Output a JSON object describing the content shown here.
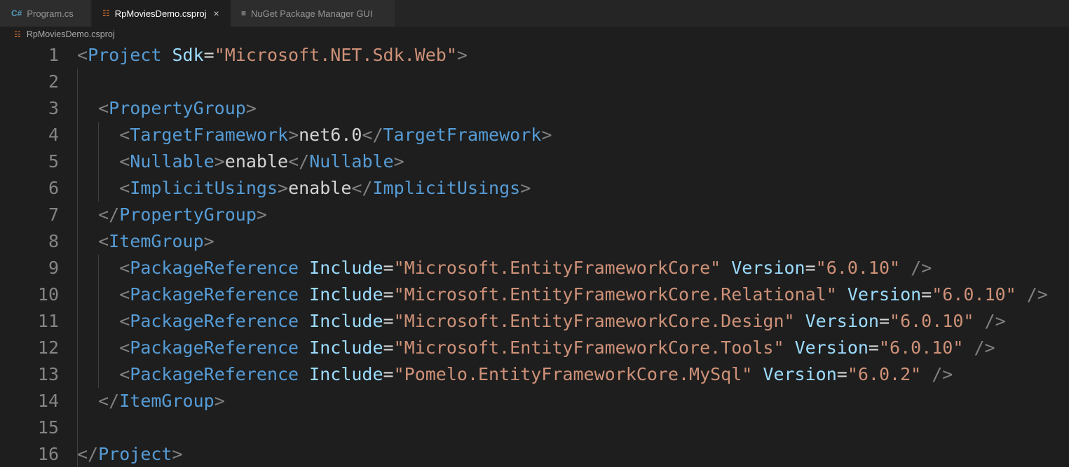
{
  "tabs": [
    {
      "icon": "csharp-file-icon",
      "label": "Program.cs",
      "active": false
    },
    {
      "icon": "rss-file-icon",
      "label": "RpMoviesDemo.csproj",
      "active": true,
      "close": "×"
    },
    {
      "icon": "preview-lines-icon",
      "label": "NuGet Package Manager GUI",
      "active": false
    }
  ],
  "breadcrumb": {
    "file": "RpMoviesDemo.csproj"
  },
  "colors": {
    "tag": "#569cd6",
    "attribute": "#9cdcfe",
    "string": "#ce9178",
    "punctuation": "#808080",
    "text": "#d4d4d4",
    "line_number": "#858585",
    "background": "#1e1e1e"
  },
  "lines": [
    {
      "n": "1",
      "tokens": [
        [
          "p",
          "<"
        ],
        [
          "t",
          "Project"
        ],
        [
          "x",
          " "
        ],
        [
          "a",
          "Sdk"
        ],
        [
          "x",
          "="
        ],
        [
          "s",
          "\"Microsoft.NET.Sdk.Web\""
        ],
        [
          "p",
          ">"
        ]
      ]
    },
    {
      "n": "2",
      "tokens": []
    },
    {
      "n": "3",
      "tokens": [
        [
          "x",
          "  "
        ],
        [
          "p",
          "<"
        ],
        [
          "t",
          "PropertyGroup"
        ],
        [
          "p",
          ">"
        ]
      ]
    },
    {
      "n": "4",
      "tokens": [
        [
          "x",
          "    "
        ],
        [
          "p",
          "<"
        ],
        [
          "t",
          "TargetFramework"
        ],
        [
          "p",
          ">"
        ],
        [
          "x",
          "net6.0"
        ],
        [
          "p",
          "</"
        ],
        [
          "t",
          "TargetFramework"
        ],
        [
          "p",
          ">"
        ]
      ]
    },
    {
      "n": "5",
      "tokens": [
        [
          "x",
          "    "
        ],
        [
          "p",
          "<"
        ],
        [
          "t",
          "Nullable"
        ],
        [
          "p",
          ">"
        ],
        [
          "x",
          "enable"
        ],
        [
          "p",
          "</"
        ],
        [
          "t",
          "Nullable"
        ],
        [
          "p",
          ">"
        ]
      ]
    },
    {
      "n": "6",
      "tokens": [
        [
          "x",
          "    "
        ],
        [
          "p",
          "<"
        ],
        [
          "t",
          "ImplicitUsings"
        ],
        [
          "p",
          ">"
        ],
        [
          "x",
          "enable"
        ],
        [
          "p",
          "</"
        ],
        [
          "t",
          "ImplicitUsings"
        ],
        [
          "p",
          ">"
        ]
      ]
    },
    {
      "n": "7",
      "tokens": [
        [
          "x",
          "  "
        ],
        [
          "p",
          "</"
        ],
        [
          "t",
          "PropertyGroup"
        ],
        [
          "p",
          ">"
        ]
      ]
    },
    {
      "n": "8",
      "tokens": [
        [
          "x",
          "  "
        ],
        [
          "p",
          "<"
        ],
        [
          "t",
          "ItemGroup"
        ],
        [
          "p",
          ">"
        ]
      ]
    },
    {
      "n": "9",
      "tokens": [
        [
          "x",
          "    "
        ],
        [
          "p",
          "<"
        ],
        [
          "t",
          "PackageReference"
        ],
        [
          "x",
          " "
        ],
        [
          "a",
          "Include"
        ],
        [
          "x",
          "="
        ],
        [
          "s",
          "\"Microsoft.EntityFrameworkCore\""
        ],
        [
          "x",
          " "
        ],
        [
          "a",
          "Version"
        ],
        [
          "x",
          "="
        ],
        [
          "s",
          "\"6.0.10\""
        ],
        [
          "x",
          " "
        ],
        [
          "p",
          "/>"
        ]
      ]
    },
    {
      "n": "10",
      "tokens": [
        [
          "x",
          "    "
        ],
        [
          "p",
          "<"
        ],
        [
          "t",
          "PackageReference"
        ],
        [
          "x",
          " "
        ],
        [
          "a",
          "Include"
        ],
        [
          "x",
          "="
        ],
        [
          "s",
          "\"Microsoft.EntityFrameworkCore.Relational\""
        ],
        [
          "x",
          " "
        ],
        [
          "a",
          "Version"
        ],
        [
          "x",
          "="
        ],
        [
          "s",
          "\"6.0.10\""
        ],
        [
          "x",
          " "
        ],
        [
          "p",
          "/>"
        ]
      ]
    },
    {
      "n": "11",
      "tokens": [
        [
          "x",
          "    "
        ],
        [
          "p",
          "<"
        ],
        [
          "t",
          "PackageReference"
        ],
        [
          "x",
          " "
        ],
        [
          "a",
          "Include"
        ],
        [
          "x",
          "="
        ],
        [
          "s",
          "\"Microsoft.EntityFrameworkCore.Design\""
        ],
        [
          "x",
          " "
        ],
        [
          "a",
          "Version"
        ],
        [
          "x",
          "="
        ],
        [
          "s",
          "\"6.0.10\""
        ],
        [
          "x",
          " "
        ],
        [
          "p",
          "/>"
        ]
      ]
    },
    {
      "n": "12",
      "tokens": [
        [
          "x",
          "    "
        ],
        [
          "p",
          "<"
        ],
        [
          "t",
          "PackageReference"
        ],
        [
          "x",
          " "
        ],
        [
          "a",
          "Include"
        ],
        [
          "x",
          "="
        ],
        [
          "s",
          "\"Microsoft.EntityFrameworkCore.Tools\""
        ],
        [
          "x",
          " "
        ],
        [
          "a",
          "Version"
        ],
        [
          "x",
          "="
        ],
        [
          "s",
          "\"6.0.10\""
        ],
        [
          "x",
          " "
        ],
        [
          "p",
          "/>"
        ]
      ]
    },
    {
      "n": "13",
      "tokens": [
        [
          "x",
          "    "
        ],
        [
          "p",
          "<"
        ],
        [
          "t",
          "PackageReference"
        ],
        [
          "x",
          " "
        ],
        [
          "a",
          "Include"
        ],
        [
          "x",
          "="
        ],
        [
          "s",
          "\"Pomelo.EntityFrameworkCore.MySql\""
        ],
        [
          "x",
          " "
        ],
        [
          "a",
          "Version"
        ],
        [
          "x",
          "="
        ],
        [
          "s",
          "\"6.0.2\""
        ],
        [
          "x",
          " "
        ],
        [
          "p",
          "/>"
        ]
      ]
    },
    {
      "n": "14",
      "tokens": [
        [
          "x",
          "  "
        ],
        [
          "p",
          "</"
        ],
        [
          "t",
          "ItemGroup"
        ],
        [
          "p",
          ">"
        ]
      ]
    },
    {
      "n": "15",
      "tokens": []
    },
    {
      "n": "16",
      "tokens": [
        [
          "p",
          "</"
        ],
        [
          "t",
          "Project"
        ],
        [
          "p",
          ">"
        ]
      ]
    }
  ]
}
